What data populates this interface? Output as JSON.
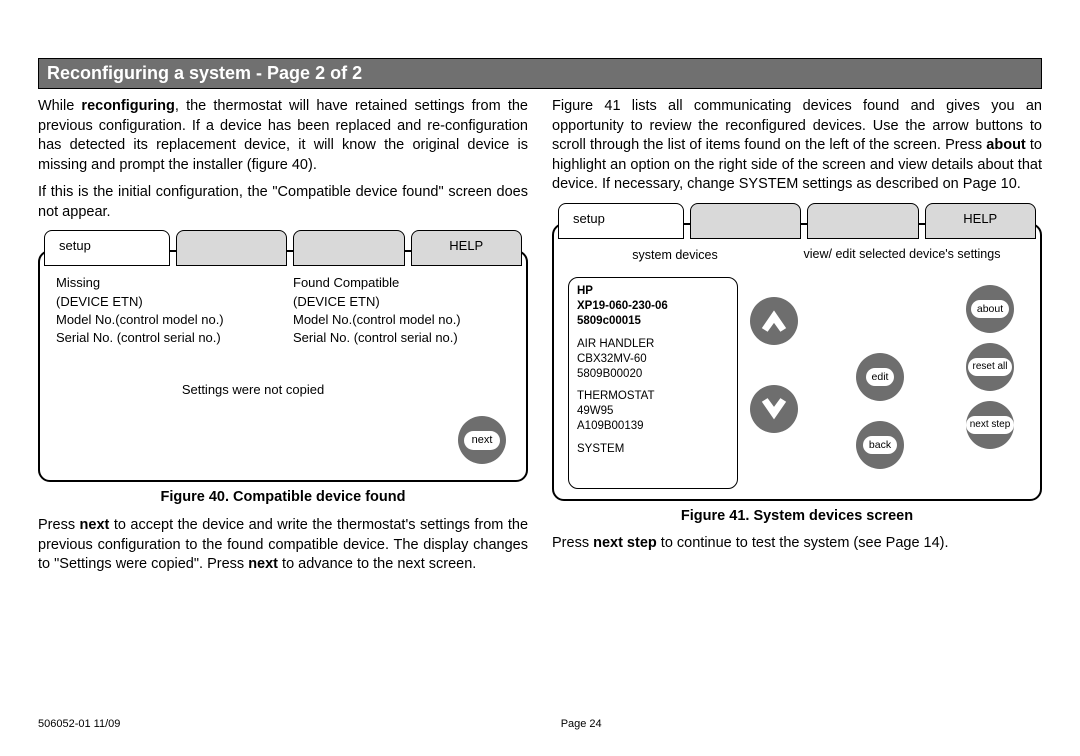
{
  "heading": "Reconfiguring a system - Page 2 of 2",
  "left": {
    "p1a": "While ",
    "p1b_bold": "reconfiguring",
    "p1c": ", the thermostat will have retained settings from the previous configuration. If a device has been replaced and re-configuration has detected its replacement device, it will know the original device is missing and prompt the installer (figure 40).",
    "p2": "If this is the initial configuration, the \"Compatible device found\" screen does not appear.",
    "p3a": "Press ",
    "p3b_bold": "next",
    "p3c": " to accept the device and write the thermostat's settings from the previous configuration to the found compatible device. The display changes to \"Settings were copied\". Press ",
    "p3d_bold": "next",
    "p3e": " to advance to the next screen."
  },
  "right": {
    "p1a": "Figure 41 lists all communicating devices found and gives you an opportunity to review the reconfigured devices. Use the arrow buttons to scroll through the list of items found on the left of the screen. Press ",
    "p1b_bold": "about",
    "p1c": " to highlight an option on the right side of the screen and view details about that device. If necessary, change SYSTEM settings as described on Page 10.",
    "p2a": "Press ",
    "p2b_bold": "next step",
    "p2c": " to continue to test the system (see Page 14)."
  },
  "fig40": {
    "tabs": {
      "setup": "setup",
      "help": "HELP"
    },
    "col1": {
      "l1": "Missing",
      "l2": "(DEVICE ETN)",
      "l3": "Model No.(control model no.)",
      "l4": "Serial No. (control serial no.)"
    },
    "col2": {
      "l1": "Found Compatible",
      "l2": "(DEVICE ETN)",
      "l3": "Model No.(control model no.)",
      "l4": "Serial No. (control serial no.)"
    },
    "status": "Settings were not copied",
    "next": "next",
    "caption": "Figure 40. Compatible device found"
  },
  "fig41": {
    "tabs": {
      "setup": "setup",
      "help": "HELP"
    },
    "head_left": "system devices",
    "head_right": "view/ edit selected device's settings",
    "devices": [
      {
        "l1": "HP",
        "l2": "XP19-060-230-06",
        "l3": "5809c00015",
        "selected": true
      },
      {
        "l1": "AIR HANDLER",
        "l2": "CBX32MV-60",
        "l3": "5809B00020",
        "selected": false
      },
      {
        "l1": "THERMOSTAT",
        "l2": "49W95",
        "l3": "A109B00139",
        "selected": false
      },
      {
        "l1": "SYSTEM",
        "l2": "",
        "l3": "",
        "selected": false
      }
    ],
    "btn_about": "about",
    "btn_reset": "reset all",
    "btn_nextstep": "next step",
    "btn_edit": "edit",
    "btn_back": "back",
    "caption": "Figure 41. System devices screen"
  },
  "footer": {
    "left": "506052-01 11/09",
    "center": "Page 24"
  }
}
